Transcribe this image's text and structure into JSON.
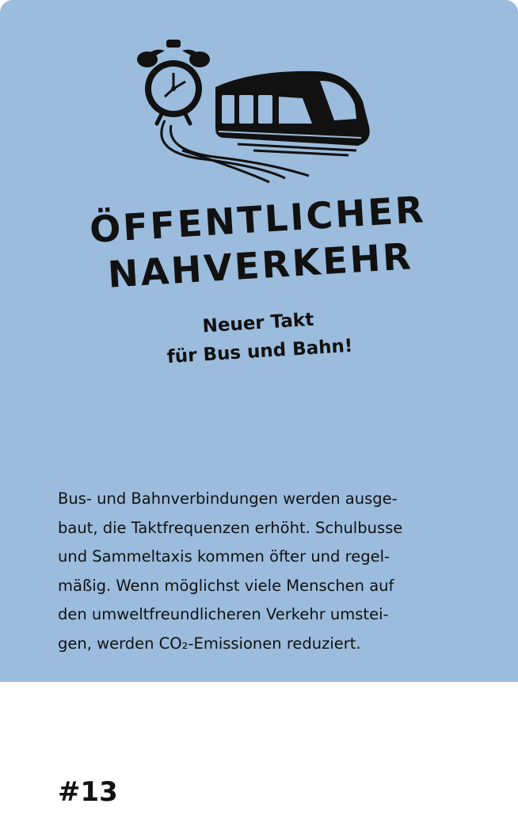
{
  "card": {
    "background_color": "#9bbcdc",
    "illustration": {
      "icons": [
        "alarm-clock-icon",
        "tram-icon"
      ]
    },
    "title_lines": [
      "ÖFFENTLICHER",
      "NAHVERKEHR"
    ],
    "subtitle_lines": [
      "Neuer Takt",
      "für Bus und Bahn!"
    ],
    "body_lines": [
      "Bus- und Bahnverbindungen werden ausge-",
      "baut, die Taktfrequenzen erhöht. Schulbusse",
      "und Sammeltaxis kommen öfter und regel-",
      "mäßig. Wenn möglichst viele Menschen auf",
      "den umweltfreundlicheren Verkehr umstei-",
      "gen, werden CO₂-Emissionen reduziert."
    ]
  },
  "footer": {
    "number": "#13"
  }
}
